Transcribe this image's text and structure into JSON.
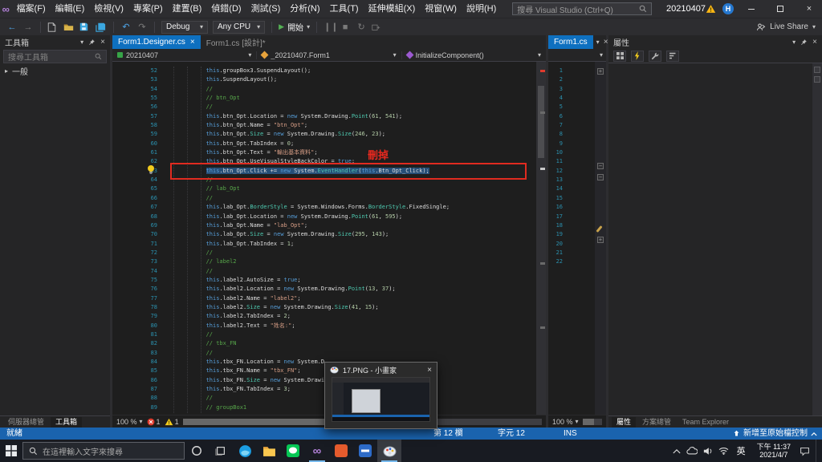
{
  "app": {
    "name": "Microsoft Visual Studio"
  },
  "colors": {
    "accent_blue": "#0E70C0",
    "statusbar_blue": "#1A63AE",
    "selection_blue": "#264F78",
    "annotation_red": "#E02B20",
    "comment_green": "#57A64A",
    "string_orange": "#D69D85",
    "keyword_blue": "#569CD6",
    "number_green": "#B5CEA8",
    "type_teal": "#4EC9B0",
    "line_number_teal": "#2B91AF",
    "warning_yellow": "#FDB714",
    "error_red": "#E03B2D"
  },
  "titlebar": {
    "menus": [
      "檔案(F)",
      "編輯(E)",
      "檢視(V)",
      "專案(P)",
      "建置(B)",
      "偵錯(D)",
      "測試(S)",
      "分析(N)",
      "工具(T)",
      "延伸模組(X)",
      "視窗(W)",
      "說明(H)"
    ],
    "search_placeholder": "搜尋 Visual Studio (Ctrl+Q)",
    "solution_name": "20210407",
    "avatar_initial": "H"
  },
  "toolbar": {
    "configuration": "Debug",
    "platform": "Any CPU",
    "start_label": "開始",
    "live_share_label": "Live Share"
  },
  "toolbox": {
    "title": "工具箱",
    "search_placeholder": "搜尋工具箱",
    "group_label": "一般"
  },
  "panel_tabs": {
    "left": [
      "伺服器總管",
      "工具箱"
    ],
    "right": [
      "屬性",
      "方案總管",
      "Team Explorer"
    ]
  },
  "editor": {
    "tabs": [
      {
        "label": "Form1.Designer.cs",
        "active": true
      },
      {
        "label": "Form1.cs [設計]*",
        "active": false
      }
    ],
    "breadcrumbs": [
      "20210407",
      "_20210407.Form1",
      "InitializeComponent()"
    ],
    "zoom": "100 %",
    "error_count": "1",
    "warning_count": "1",
    "annotation": {
      "label": "刪掉"
    },
    "selected_line": 63,
    "code_lines": [
      {
        "n": 52,
        "t": "            this.groupBox3.SuspendLayout();"
      },
      {
        "n": 53,
        "t": "            this.SuspendLayout();"
      },
      {
        "n": 54,
        "t": "            // "
      },
      {
        "n": 55,
        "t": "            // btn_Opt"
      },
      {
        "n": 56,
        "t": "            // "
      },
      {
        "n": 57,
        "t": "            this.btn_Opt.Location = new System.Drawing.Point(61, 541);"
      },
      {
        "n": 58,
        "t": "            this.btn_Opt.Name = \"btn_Opt\";"
      },
      {
        "n": 59,
        "t": "            this.btn_Opt.Size = new System.Drawing.Size(246, 23);"
      },
      {
        "n": 60,
        "t": "            this.btn_Opt.TabIndex = 0;"
      },
      {
        "n": 61,
        "t": "            this.btn_Opt.Text = \"輸出基本資料\";"
      },
      {
        "n": 62,
        "t": "            this.btn_Opt.UseVisualStyleBackColor = true;"
      },
      {
        "n": 63,
        "t": "            this.btn_Opt.Click += new System.EventHandler(this.Btn_Opt_Click);",
        "sel": true
      },
      {
        "n": 64,
        "t": "            // "
      },
      {
        "n": 65,
        "t": "            // lab_Opt"
      },
      {
        "n": 66,
        "t": "            // "
      },
      {
        "n": 67,
        "t": "            this.lab_Opt.BorderStyle = System.Windows.Forms.BorderStyle.FixedSingle;"
      },
      {
        "n": 68,
        "t": "            this.lab_Opt.Location = new System.Drawing.Point(61, 595);"
      },
      {
        "n": 69,
        "t": "            this.lab_Opt.Name = \"lab_Opt\";"
      },
      {
        "n": 70,
        "t": "            this.lab_Opt.Size = new System.Drawing.Size(295, 143);"
      },
      {
        "n": 71,
        "t": "            this.lab_Opt.TabIndex = 1;"
      },
      {
        "n": 72,
        "t": "            // "
      },
      {
        "n": 73,
        "t": "            // label2"
      },
      {
        "n": 74,
        "t": "            // "
      },
      {
        "n": 75,
        "t": "            this.label2.AutoSize = true;"
      },
      {
        "n": 76,
        "t": "            this.label2.Location = new System.Drawing.Point(13, 37);"
      },
      {
        "n": 77,
        "t": "            this.label2.Name = \"label2\";"
      },
      {
        "n": 78,
        "t": "            this.label2.Size = new System.Drawing.Size(41, 15);"
      },
      {
        "n": 79,
        "t": "            this.label2.TabIndex = 2;"
      },
      {
        "n": 80,
        "t": "            this.label2.Text = \"姓名:\";"
      },
      {
        "n": 81,
        "t": "            // "
      },
      {
        "n": 82,
        "t": "            // tbx_FN"
      },
      {
        "n": 83,
        "t": "            // "
      },
      {
        "n": 84,
        "t": "            this.tbx_FN.Location = new System.D"
      },
      {
        "n": 85,
        "t": "            this.tbx_FN.Name = \"tbx_FN\";"
      },
      {
        "n": 86,
        "t": "            this.tbx_FN.Size = new System.Drawi"
      },
      {
        "n": 87,
        "t": "            this.tbx_FN.TabIndex = 3;"
      },
      {
        "n": 88,
        "t": "            // "
      },
      {
        "n": 89,
        "t": "            // groupBox1"
      }
    ]
  },
  "editor2": {
    "tab_label": "Form1.cs",
    "zoom": "100 %",
    "line_count": 22
  },
  "properties_panel": {
    "title": "屬性"
  },
  "statusbar": {
    "ready": "就緒",
    "column": "第 12 欄",
    "character": "字元 12",
    "insert_mode": "INS",
    "source_control": "新增至原始檔控制"
  },
  "taskbar": {
    "search_placeholder": "在這裡輸入文字來搜尋",
    "ime_label": "英",
    "time": "下午 11:37",
    "date": "2021/4/7",
    "icons": [
      "start",
      "search",
      "cortana",
      "task-view",
      "browser",
      "file-explorer",
      "green-app",
      "visual-studio",
      "orange-app",
      "blue-app",
      "paint",
      "tray-expand",
      "onedrive",
      "volume",
      "wifi",
      "ime",
      "clock",
      "action-center"
    ]
  },
  "thumbnail_popup": {
    "title": "17.PNG - 小畫家"
  }
}
